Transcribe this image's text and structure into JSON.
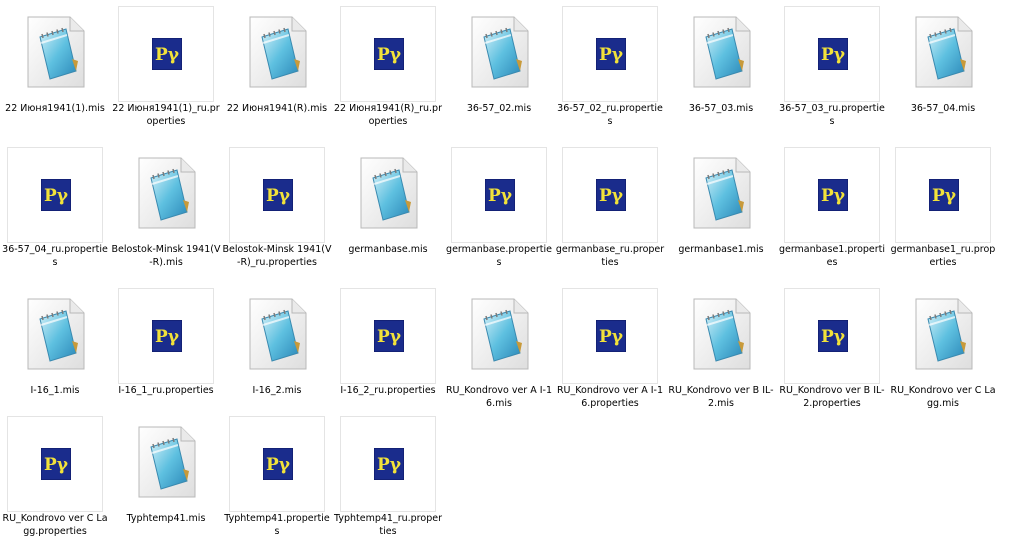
{
  "files": [
    {
      "name": "22 Июня1941(1).mis",
      "type": "mis"
    },
    {
      "name": "22 Июня1941(1)_ru.properties",
      "type": "properties"
    },
    {
      "name": "22 Июня1941(R).mis",
      "type": "mis"
    },
    {
      "name": "22 Июня1941(R)_ru.properties",
      "type": "properties"
    },
    {
      "name": "36-57_02.mis",
      "type": "mis"
    },
    {
      "name": "36-57_02_ru.properties",
      "type": "properties"
    },
    {
      "name": "36-57_03.mis",
      "type": "mis"
    },
    {
      "name": "36-57_03_ru.properties",
      "type": "properties"
    },
    {
      "name": "36-57_04.mis",
      "type": "mis"
    },
    {
      "name": "36-57_04_ru.properties",
      "type": "properties"
    },
    {
      "name": "Belostok-Minsk 1941(V-R).mis",
      "type": "mis"
    },
    {
      "name": "Belostok-Minsk 1941(V-R)_ru.properties",
      "type": "properties"
    },
    {
      "name": "germanbase.mis",
      "type": "mis"
    },
    {
      "name": "germanbase.properties",
      "type": "properties"
    },
    {
      "name": "germanbase_ru.properties",
      "type": "properties"
    },
    {
      "name": "germanbase1.mis",
      "type": "mis"
    },
    {
      "name": "germanbase1.properties",
      "type": "properties"
    },
    {
      "name": "germanbase1_ru.properties",
      "type": "properties"
    },
    {
      "name": "I-16_1.mis",
      "type": "mis"
    },
    {
      "name": "I-16_1_ru.properties",
      "type": "properties"
    },
    {
      "name": "I-16_2.mis",
      "type": "mis"
    },
    {
      "name": "I-16_2_ru.properties",
      "type": "properties"
    },
    {
      "name": "RU_Kondrovo ver A I-16.mis",
      "type": "mis"
    },
    {
      "name": "RU_Kondrovo ver A I-16.properties",
      "type": "properties"
    },
    {
      "name": "RU_Kondrovo ver B IL-2.mis",
      "type": "mis"
    },
    {
      "name": "RU_Kondrovo ver B IL-2.properties",
      "type": "properties"
    },
    {
      "name": "RU_Kondrovo ver C Lagg.mis",
      "type": "mis"
    },
    {
      "name": "RU_Kondrovo ver C Lagg.properties",
      "type": "properties"
    },
    {
      "name": "Typhtemp41.mis",
      "type": "mis"
    },
    {
      "name": "Typhtemp41.properties",
      "type": "properties"
    },
    {
      "name": "Typhtemp41_ru.properties",
      "type": "properties"
    }
  ],
  "icons": {
    "mis": "notepad-document-icon",
    "properties": "py-file-icon"
  },
  "colors": {
    "py_bg": "#1a2c8c",
    "py_glyph": "#f2e23a"
  }
}
